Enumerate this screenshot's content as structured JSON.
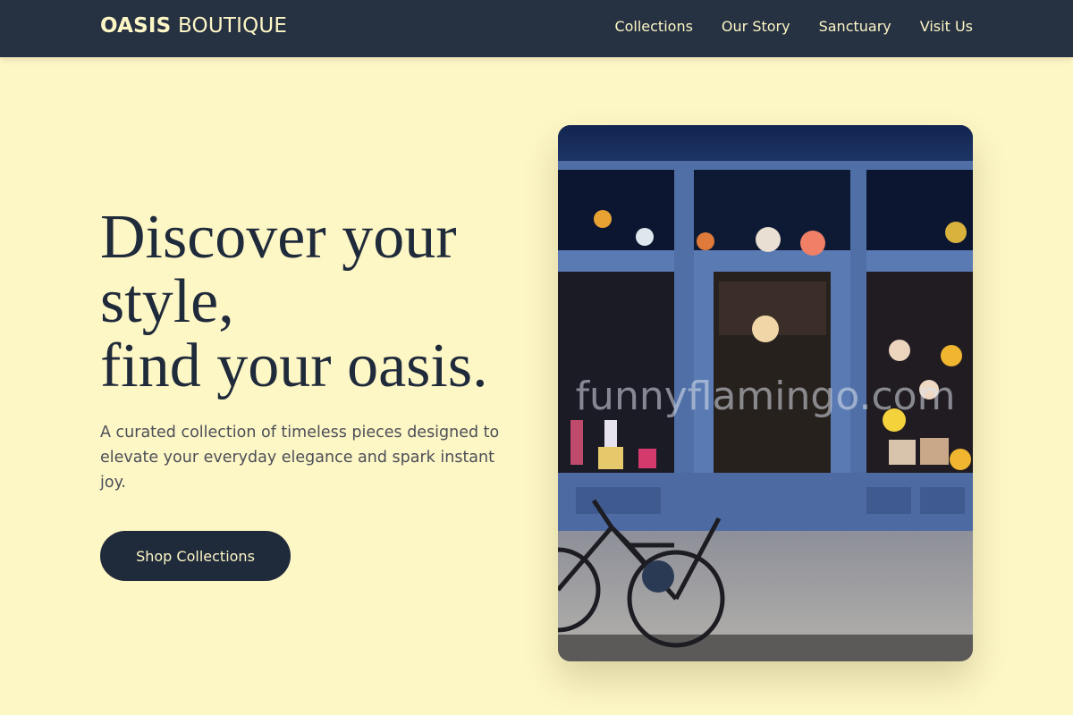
{
  "header": {
    "brand_strong": "OASIS",
    "brand_light": "BOUTIQUE",
    "nav": [
      "Collections",
      "Our Story",
      "Sanctuary",
      "Visit Us"
    ]
  },
  "hero": {
    "title_lines": [
      "Discover your",
      "style,",
      "find your oasis."
    ],
    "subtitle": "A curated collection of timeless pieces designed to elevate your everyday elegance and spark instant joy.",
    "cta_label": "Shop Collections",
    "image_watermark": "funnyflamingo.com"
  },
  "colors": {
    "background": "#fdf6c5",
    "header": "#263142",
    "accent_text": "#fdf6c5",
    "heading": "#1f2a3b",
    "storefront_blue": "#4f6fa6"
  }
}
